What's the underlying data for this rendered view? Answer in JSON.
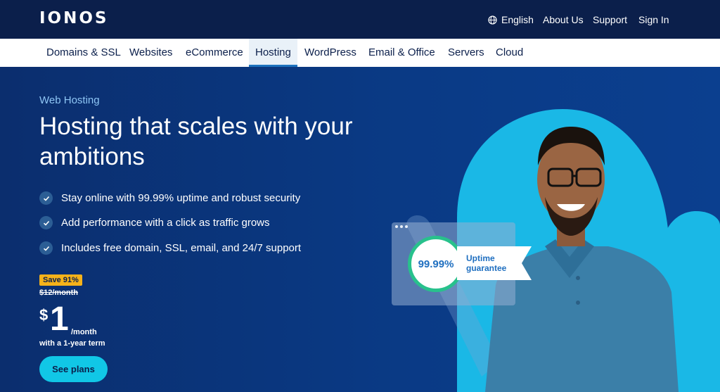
{
  "brand": {
    "logo": "IONOS"
  },
  "utility_nav": {
    "language": "English",
    "about": "About Us",
    "support": "Support",
    "sign_in": "Sign In"
  },
  "main_nav": {
    "items": [
      {
        "label": "Domains & SSL"
      },
      {
        "label": "Websites"
      },
      {
        "label": "eCommerce"
      },
      {
        "label": "Hosting",
        "active": true
      },
      {
        "label": "WordPress"
      },
      {
        "label": "Email & Office"
      },
      {
        "label": "Servers"
      },
      {
        "label": "Cloud"
      }
    ]
  },
  "hero": {
    "eyebrow": "Web Hosting",
    "headline": "Hosting that scales with your ambitions",
    "features": [
      "Stay online with 99.99% uptime and robust security",
      "Add performance with a click as traffic grows",
      "Includes free domain, SSL, email, and 24/7 support"
    ],
    "pricing": {
      "badge": "Save 91%",
      "old_price": "$12/month",
      "currency": "$",
      "amount": "1",
      "per": "/month",
      "term": "with a 1-year term"
    },
    "cta": "See plans",
    "uptime": {
      "value": "99.99%",
      "label_line1": "Uptime",
      "label_line2": "guarantee"
    }
  },
  "colors": {
    "topbar": "#0b1f4b",
    "hero_bg": "#0b3a85",
    "accent_cyan": "#11c7e6",
    "badge_yellow": "#f5b21a",
    "uptime_green": "#28c18c"
  },
  "icons": {
    "language": "globe-icon",
    "feature": "check-icon"
  }
}
